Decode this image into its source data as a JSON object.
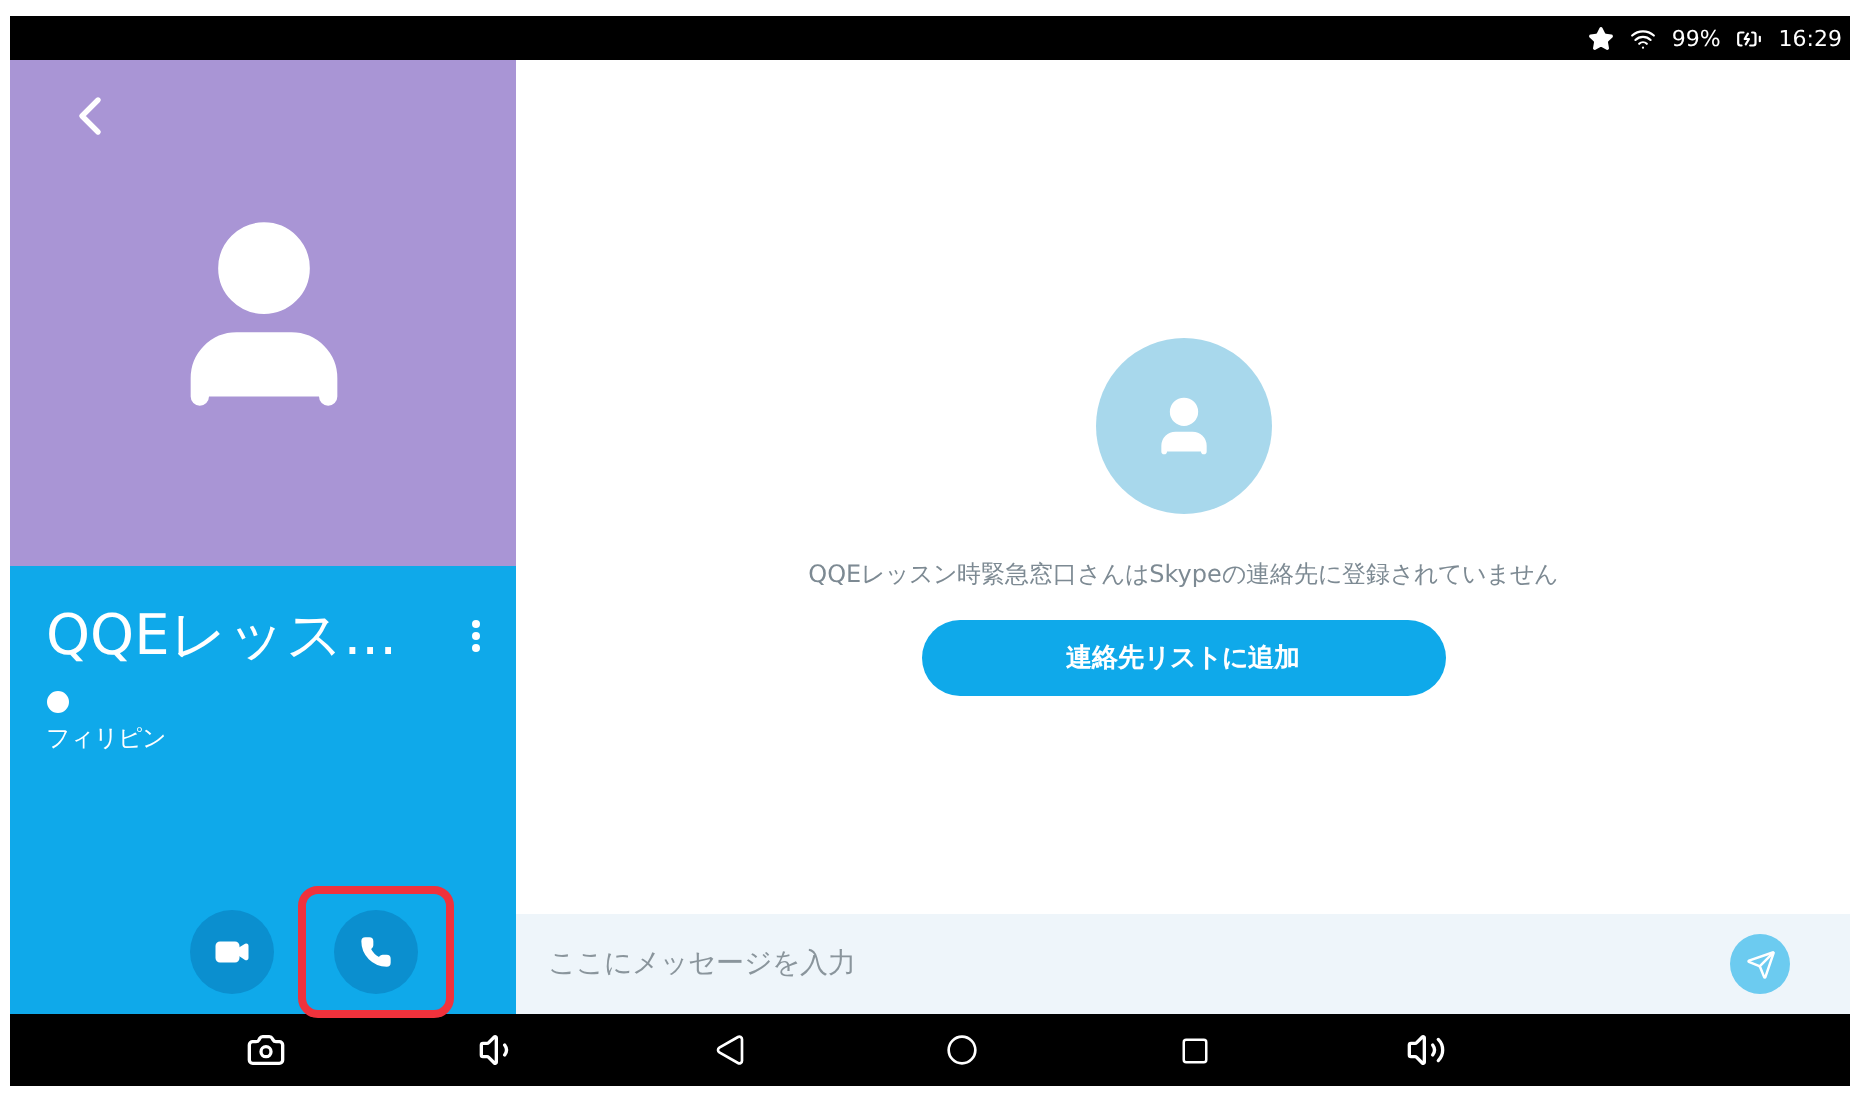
{
  "status_bar": {
    "battery": "99%",
    "time": "16:29"
  },
  "contact": {
    "name": "QQEレッス...",
    "location": "フィリピン"
  },
  "call_actions": [
    {
      "kind": "video",
      "highlighted": false
    },
    {
      "kind": "voice",
      "highlighted": true
    }
  ],
  "notice": {
    "message": "QQEレッスン時緊急窓口さんはSkypeの連絡先に登録されていません",
    "button": "連絡先リストに追加"
  },
  "composer": {
    "placeholder": "ここにメッセージを入力"
  }
}
